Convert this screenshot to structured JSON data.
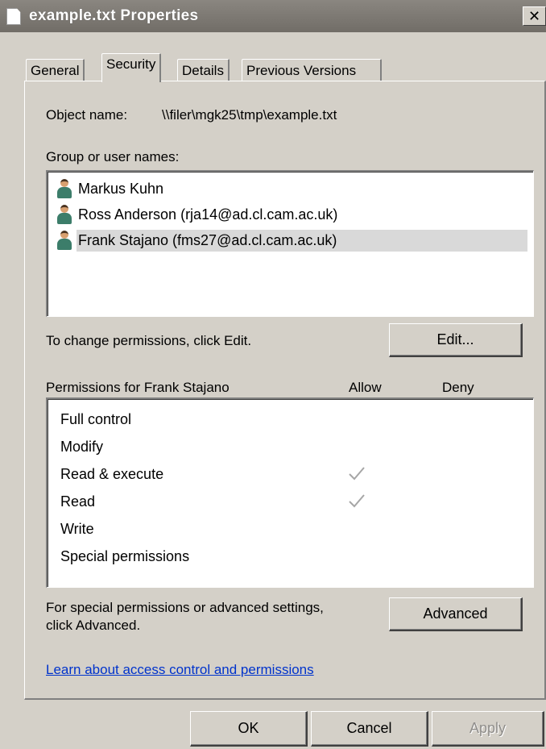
{
  "window": {
    "title": "example.txt Properties",
    "close_glyph": "✕"
  },
  "tabs": [
    {
      "label": "General",
      "active": false
    },
    {
      "label": "Security",
      "active": true
    },
    {
      "label": "Details",
      "active": false
    },
    {
      "label": "Previous Versions",
      "active": false
    }
  ],
  "security": {
    "object_name_label": "Object name:",
    "object_name_value": "\\\\filer\\mgk25\\tmp\\example.txt",
    "group_label": "Group or user names:",
    "users": [
      {
        "name": "Markus Kuhn",
        "selected": false,
        "icon": "user-icon"
      },
      {
        "name": "Ross Anderson (rja14@ad.cl.cam.ac.uk)",
        "selected": false,
        "icon": "user-icon"
      },
      {
        "name": "Frank Stajano (fms27@ad.cl.cam.ac.uk)",
        "selected": true,
        "icon": "user-icon"
      }
    ],
    "change_hint": "To change permissions, click Edit.",
    "edit_button": "Edit...",
    "permissions_header": "Permissions for Frank Stajano",
    "allow_header": "Allow",
    "deny_header": "Deny",
    "permissions": [
      {
        "name": "Full control",
        "allow": false,
        "deny": false
      },
      {
        "name": "Modify",
        "allow": false,
        "deny": false
      },
      {
        "name": "Read & execute",
        "allow": true,
        "deny": false
      },
      {
        "name": "Read",
        "allow": true,
        "deny": false
      },
      {
        "name": "Write",
        "allow": false,
        "deny": false
      },
      {
        "name": "Special permissions",
        "allow": false,
        "deny": false
      }
    ],
    "advanced_hint_line1": "For special permissions or advanced settings,",
    "advanced_hint_line2": "click Advanced.",
    "advanced_button": "Advanced",
    "learn_link": "Learn about access control and permissions"
  },
  "footer": {
    "ok": "OK",
    "cancel": "Cancel",
    "apply": "Apply"
  },
  "colors": {
    "face": "#d4d0c8",
    "link": "#0033cc",
    "titlebar": "#7b7771"
  }
}
